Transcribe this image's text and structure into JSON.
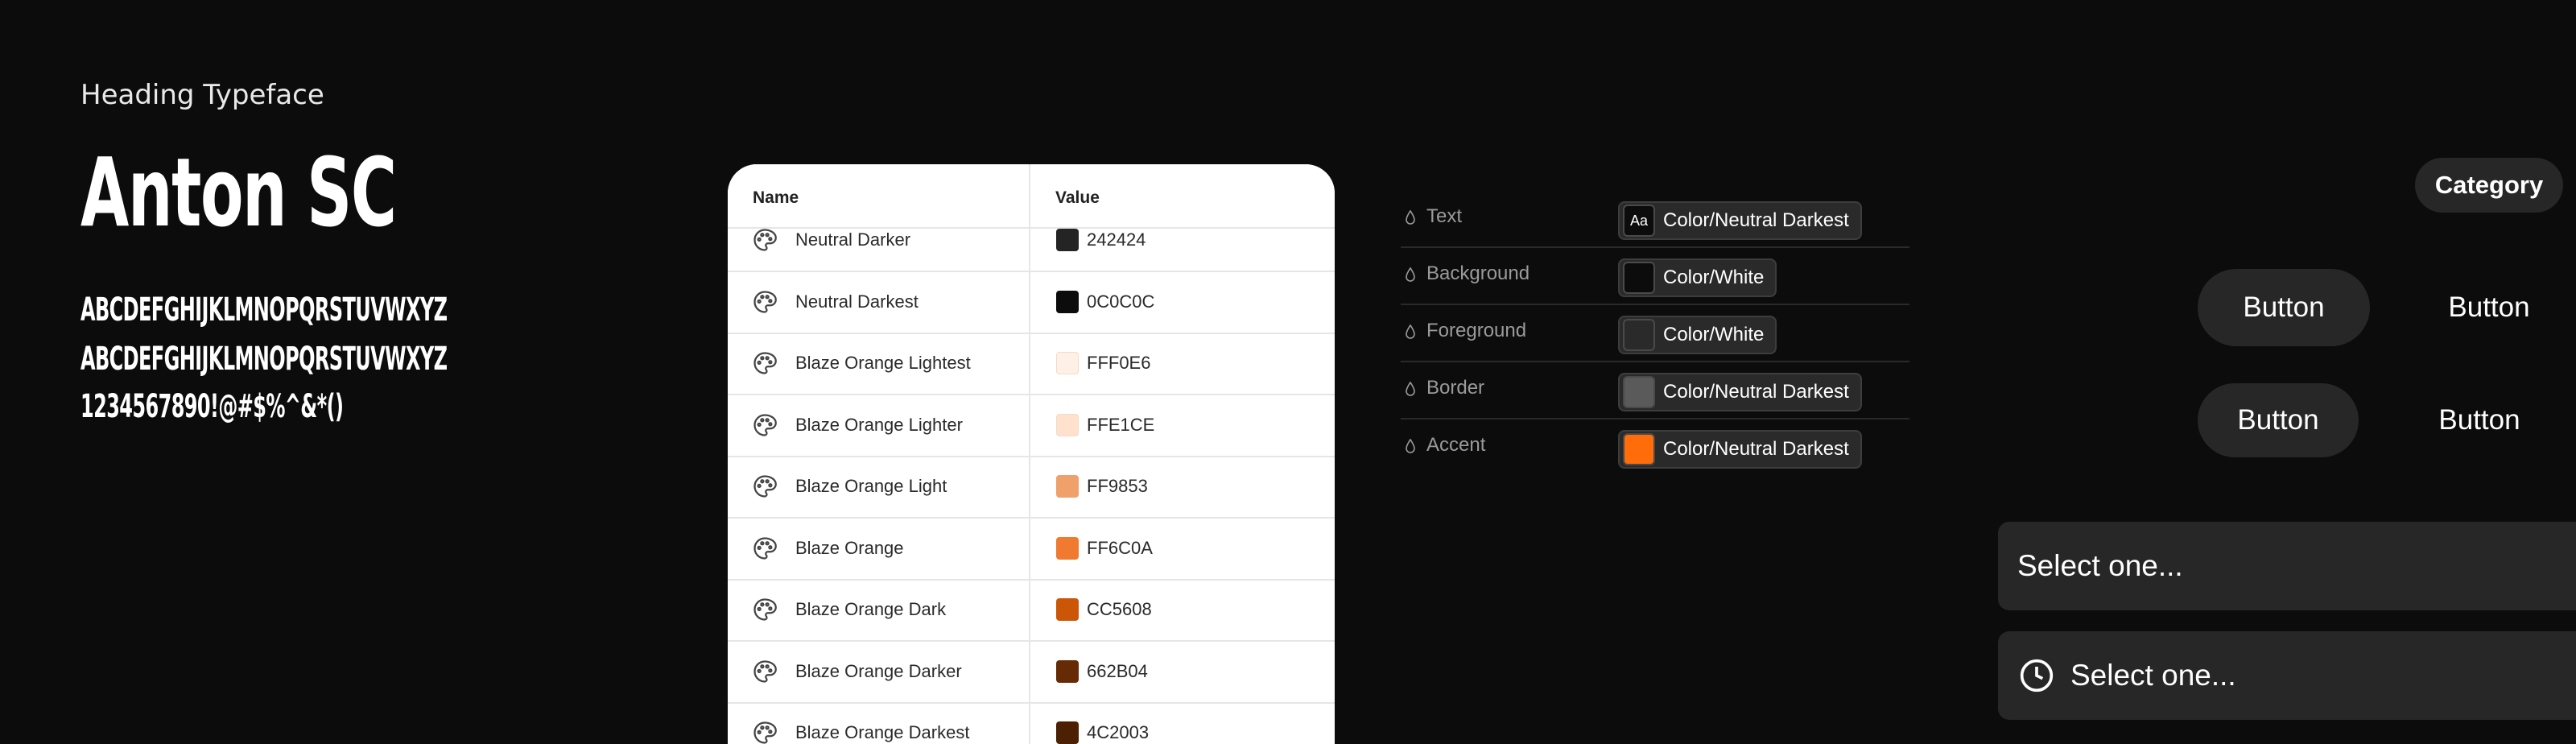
{
  "typography": {
    "heading_label": "Heading Typeface",
    "font_name": "Anton SC",
    "glyphs_upper": "ABCDEFGHIJKLMNOPQRSTUVWXYZ",
    "glyphs_lower": "ABCDEFGHIJKLMNOPQRSTUVWXYZ",
    "glyphs_numbers": "1234567890!@#$%^&*()"
  },
  "color_table": {
    "headers": {
      "name": "Name",
      "value": "Value"
    },
    "rows": [
      {
        "name": "Neutral Darker",
        "value": "242424",
        "color": "#242424"
      },
      {
        "name": "Neutral Darkest",
        "value": "0C0C0C",
        "color": "#0C0C0C"
      },
      {
        "name": "Blaze Orange Lightest",
        "value": "FFF0E6",
        "color": "#FFF0E6"
      },
      {
        "name": "Blaze Orange Lighter",
        "value": "FFE1CE",
        "color": "#FFE1CE"
      },
      {
        "name": "Blaze Orange Light",
        "value": "FF9853",
        "color": "#F0A06A"
      },
      {
        "name": "Blaze Orange",
        "value": "FF6C0A",
        "color": "#F07A30"
      },
      {
        "name": "Blaze Orange Dark",
        "value": "CC5608",
        "color": "#CC5608"
      },
      {
        "name": "Blaze Orange Darker",
        "value": "662B04",
        "color": "#662B04"
      },
      {
        "name": "Blaze Orange Darkest",
        "value": "4C2003",
        "color": "#4C2003"
      }
    ],
    "icon": "palette-icon"
  },
  "tokens": [
    {
      "label": "Text",
      "value": "Color/Neutral Darkest",
      "swatch": "#0C0C0C",
      "swatch_text": "Aa"
    },
    {
      "label": "Background",
      "value": "Color/White",
      "swatch": "#0C0C0C",
      "swatch_text": ""
    },
    {
      "label": "Foreground",
      "value": "Color/White",
      "swatch": "#2A2A2A",
      "swatch_text": ""
    },
    {
      "label": "Border",
      "value": "Color/Neutral Darkest",
      "swatch": "#5A5A5A",
      "swatch_text": ""
    },
    {
      "label": "Accent",
      "value": "Color/Neutral Darkest",
      "swatch": "#FF6C0A",
      "swatch_text": ""
    }
  ],
  "components": {
    "category": "Category",
    "buttons": [
      "Button",
      "Button",
      "Button",
      "Button"
    ],
    "select_placeholder": "Select one...",
    "select_with_icon_placeholder": "Select one..."
  },
  "colors": {
    "page_background": "#0C0C0C",
    "surface": "#272727",
    "accent": "#FF6C0A"
  }
}
